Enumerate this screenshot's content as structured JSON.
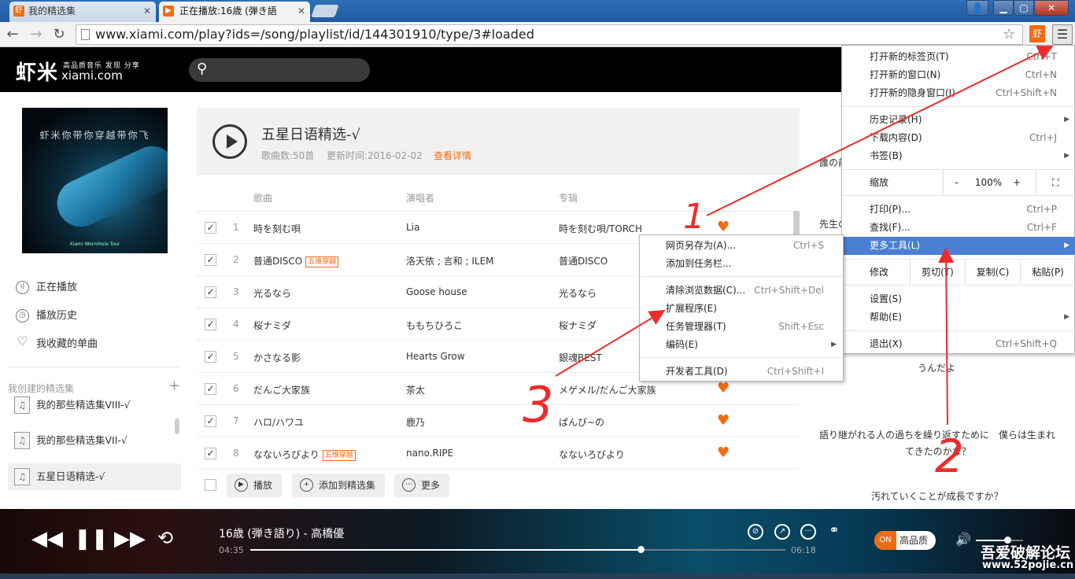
{
  "browser": {
    "tabs": [
      {
        "title": "我的精选集"
      },
      {
        "title": "正在播放:16歳 (弾き語"
      }
    ],
    "url": "www.xiami.com/play?ids=/song/playlist/id/144301910/type/3#loaded"
  },
  "site": {
    "logo_cn": "虾米",
    "logo_tag": "高品质音乐 发现 分享",
    "logo_en": "xiami.com",
    "search_placeholder": ""
  },
  "cover": {
    "text": "虾米你带你穿越带你飞",
    "sub": "Xiami Wormhole Tour"
  },
  "sidebar": {
    "nav": [
      {
        "label": "正在播放"
      },
      {
        "label": "播放历史"
      },
      {
        "label": "我收藏的单曲"
      }
    ],
    "section_title": "我创建的精选集",
    "playlists": [
      {
        "label": "我的那些精选集VIII-√"
      },
      {
        "label": "我的那些精选集VII-√"
      },
      {
        "label": "五星日语精选-√"
      }
    ]
  },
  "playlist": {
    "title": "五星日语精选-√",
    "count": "歌曲数:50首",
    "updated": "更新时间:2016-02-02",
    "detail_link": "查看详情"
  },
  "columns": {
    "song": "歌曲",
    "artist": "演唱者",
    "album": "专辑"
  },
  "songs": [
    {
      "n": "1",
      "title": "時を刻む唄",
      "tag": "",
      "artist": "Lia",
      "album": "時を刻む唄/TORCH"
    },
    {
      "n": "2",
      "title": "普通DISCO",
      "tag": "五维穿越",
      "artist": "洛天依 ; 言和 ; ILEM",
      "album": "普通DISCO"
    },
    {
      "n": "3",
      "title": "光るなら",
      "tag": "",
      "artist": "Goose house",
      "album": "光るなら"
    },
    {
      "n": "4",
      "title": "桜ナミダ",
      "tag": "",
      "artist": "ももちひろこ",
      "album": "桜ナミダ"
    },
    {
      "n": "5",
      "title": "かさなる影",
      "tag": "",
      "artist": "Hearts Grow",
      "album": "銀魂BEST"
    },
    {
      "n": "6",
      "title": "だんご大家族",
      "tag": "",
      "artist": "茶太",
      "album": "メゲメル/だんご大家族"
    },
    {
      "n": "7",
      "title": "ハロ/ハワユ",
      "tag": "",
      "artist": "鹿乃",
      "album": "ぱんぴ~の"
    },
    {
      "n": "8",
      "title": "なないろびより",
      "tag": "五维穿越",
      "artist": "nano.RIPE",
      "album": "なないろびより"
    }
  ],
  "actions": {
    "play": "播放",
    "add": "添加到精选集",
    "more": "更多"
  },
  "lyrics": [
    "誰の前",
    "先生の",
    "うんだよ",
    "語り継がれる人の過ちを繰り返すために　僕らは生まれ",
    "てきたのかな？",
    "汚れていくことが成長ですか？"
  ],
  "player": {
    "song": "16歳 (弾き語り) - 高橋優",
    "elapsed": "04:35",
    "duration": "06:18",
    "progress": 0.73,
    "volume": 0.67,
    "toggle_on": "ON",
    "quality": "高品质"
  },
  "chrome_menu": {
    "group1": [
      {
        "label": "打开新的标签页(T)",
        "shortcut": "Ctrl+T"
      },
      {
        "label": "打开新的窗口(N)",
        "shortcut": "Ctrl+N"
      },
      {
        "label": "打开新的隐身窗口(I)",
        "shortcut": "Ctrl+Shift+N"
      }
    ],
    "group2": [
      {
        "label": "历史记录(H)",
        "shortcut": ""
      },
      {
        "label": "下载内容(D)",
        "shortcut": "Ctrl+J"
      },
      {
        "label": "书签(B)",
        "shortcut": ""
      }
    ],
    "zoom_label": "缩放",
    "zoom_minus": "-",
    "zoom_value": "100%",
    "zoom_plus": "+",
    "group3": [
      {
        "label": "打印(P)...",
        "shortcut": "Ctrl+P"
      },
      {
        "label": "查找(F)...",
        "shortcut": "Ctrl+F"
      },
      {
        "label": "更多工具(L)",
        "shortcut": ""
      }
    ],
    "edit_label": "修改",
    "cut": "剪切(T)",
    "copy": "复制(C)",
    "paste": "粘贴(P)",
    "group4": [
      {
        "label": "设置(S)",
        "shortcut": ""
      },
      {
        "label": "帮助(E)",
        "shortcut": ""
      }
    ],
    "exit": {
      "label": "退出(X)",
      "shortcut": "Ctrl+Shift+Q"
    }
  },
  "submenu": [
    {
      "label": "网页另存为(A)...",
      "shortcut": "Ctrl+S"
    },
    {
      "label": "添加到任务栏...",
      "shortcut": ""
    },
    {
      "label": "清除浏览数据(C)...",
      "shortcut": "Ctrl+Shift+Del"
    },
    {
      "label": "扩展程序(E)",
      "shortcut": ""
    },
    {
      "label": "任务管理器(T)",
      "shortcut": "Shift+Esc"
    },
    {
      "label": "编码(E)",
      "shortcut": ""
    },
    {
      "label": "开发者工具(D)",
      "shortcut": "Ctrl+Shift+I"
    }
  ],
  "annotations": {
    "one": "1",
    "two": "2",
    "three": "3"
  },
  "watermark": {
    "line1": "吾爱破解论坛",
    "line2": "www.52pojie.cn"
  },
  "colors": {
    "accent": "#f26b12",
    "menu_highlight": "#4a7fd3",
    "annotation": "#ee2b2b"
  }
}
